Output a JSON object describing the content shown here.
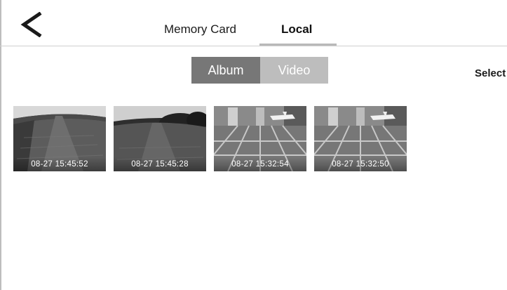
{
  "header": {
    "back_icon": "chevron-left-icon",
    "tabs": [
      {
        "label": "Memory Card",
        "active": false
      },
      {
        "label": "Local",
        "active": true
      }
    ]
  },
  "segment": {
    "options": [
      {
        "label": "Album",
        "selected": true
      },
      {
        "label": "Video",
        "selected": false
      }
    ]
  },
  "toolbar": {
    "select_label": "Select"
  },
  "gallery": {
    "items": [
      {
        "timestamp": "08-27 15:45:52",
        "scene": "grass-field"
      },
      {
        "timestamp": "08-27 15:45:28",
        "scene": "grass-field-trees"
      },
      {
        "timestamp": "08-27 15:32:54",
        "scene": "hangar-floor-airplane"
      },
      {
        "timestamp": "08-27 15:32:50",
        "scene": "hangar-floor-airplane"
      }
    ]
  },
  "colors": {
    "segment_selected": "#777777",
    "segment_unselected": "#bdbdbd",
    "tab_underline": "#b9b9b9",
    "divider": "#cfcfcf"
  }
}
